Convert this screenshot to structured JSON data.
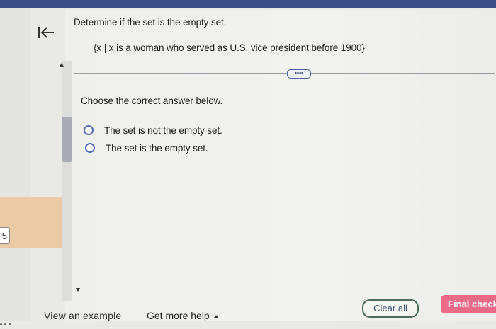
{
  "question_number": "5",
  "question": {
    "text": "Determine if the set is the empty set.",
    "set_expression": "{x | x is a woman who served as U.S. vice president before 1900}"
  },
  "more_button_label": "••••",
  "prompt": "Choose the correct answer below.",
  "options": [
    {
      "label": "The set is not the empty set."
    },
    {
      "label": "The set is the empty set."
    }
  ],
  "footer": {
    "view_example": "View an example",
    "get_more_help": "Get more help",
    "clear_all": "Clear all",
    "final_check": "Final check"
  },
  "colors": {
    "topbar": "#3c4f86",
    "radio": "#4e68b4",
    "final_check": "#e86a87"
  },
  "icons": {
    "back": "back-to-start-icon",
    "help_caret": "caret-up-icon"
  }
}
